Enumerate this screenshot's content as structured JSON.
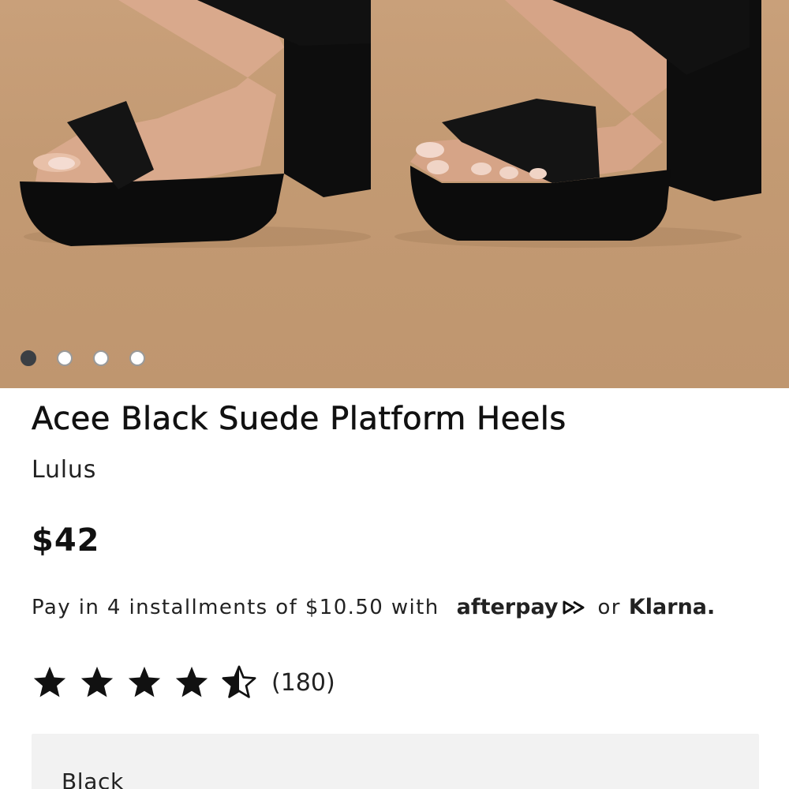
{
  "product": {
    "image_alt": "Black suede platform heels worn on feet",
    "carousel": {
      "count": 4,
      "active_index": 0
    },
    "title": "Acee Black Suede Platform Heels",
    "brand": "Lulus",
    "price": "$42"
  },
  "payment": {
    "text": "Pay in 4 installments of $10.50 with",
    "afterpay": "afterpay",
    "or": "or",
    "klarna": "Klarna."
  },
  "rating": {
    "stars": 4.5,
    "count": "(180)"
  },
  "variant": {
    "color": "Black"
  },
  "colors": {
    "background": "#c39a73",
    "text": "#111111",
    "variant_bg": "#f2f2f2",
    "dot_active": "#3b3f44"
  }
}
